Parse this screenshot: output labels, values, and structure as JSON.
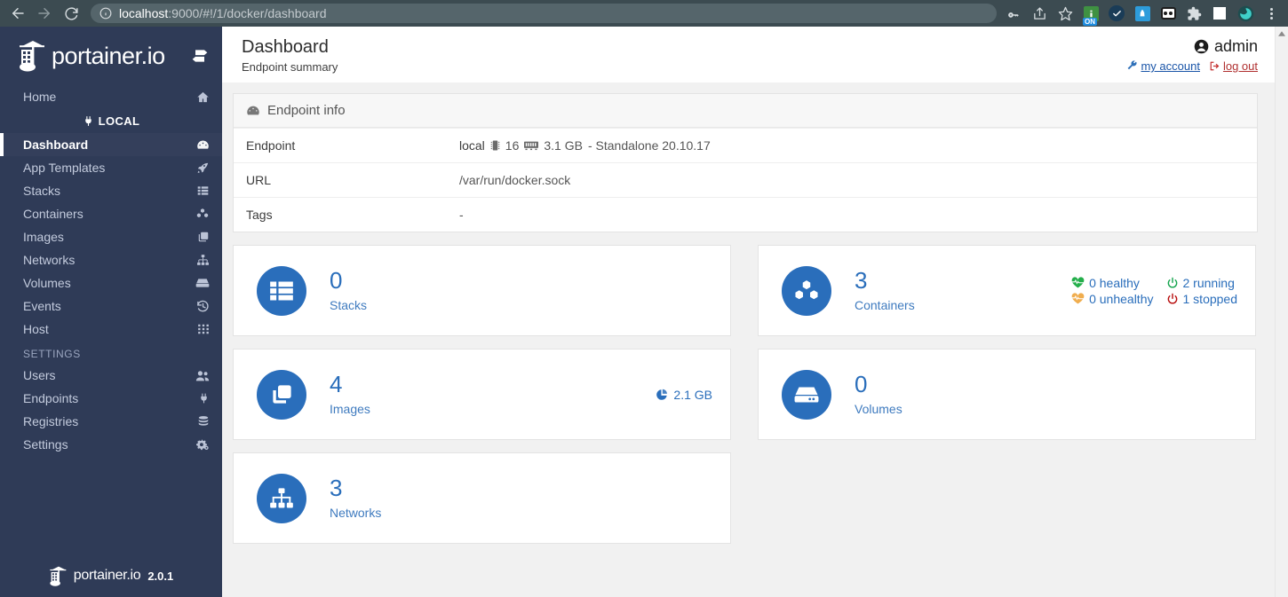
{
  "browser": {
    "back_icon": "back-arrow-icon",
    "forward_icon": "forward-arrow-icon",
    "reload_icon": "reload-icon",
    "site_info_icon": "site-info-icon",
    "url_host": "localhost",
    "url_rest": ":9000/#!/1/docker/dashboard",
    "url_full": "localhost:9000/#!/1/docker/dashboard",
    "toolbar_icons": [
      "password-key-icon",
      "share-icon",
      "bookmark-star-icon",
      "extension-on-icon",
      "extension-check-icon",
      "extension-bag-icon",
      "extension-goggles-icon",
      "extensions-puzzle-icon",
      "sidepanel-icon",
      "extension-swirl-icon",
      "chrome-menu-icon"
    ],
    "extension_badge": "ON"
  },
  "sidebar": {
    "logo_text": "portainer.io",
    "toggle_icon": "collapse-sidebar-icon",
    "home": {
      "label": "Home",
      "icon": "home-icon"
    },
    "local_badge": {
      "label": "LOCAL",
      "icon": "plug-icon"
    },
    "items": [
      {
        "label": "Dashboard",
        "icon": "dashboard-icon",
        "active": true
      },
      {
        "label": "App Templates",
        "icon": "rocket-icon",
        "active": false
      },
      {
        "label": "Stacks",
        "icon": "list-icon",
        "active": false
      },
      {
        "label": "Containers",
        "icon": "containers-icon",
        "active": false
      },
      {
        "label": "Images",
        "icon": "images-icon",
        "active": false
      },
      {
        "label": "Networks",
        "icon": "sitemap-icon",
        "active": false
      },
      {
        "label": "Volumes",
        "icon": "hdd-icon",
        "active": false
      },
      {
        "label": "Events",
        "icon": "history-icon",
        "active": false
      },
      {
        "label": "Host",
        "icon": "grid-icon",
        "active": false
      }
    ],
    "settings_title": "SETTINGS",
    "settings_items": [
      {
        "label": "Users",
        "icon": "users-icon"
      },
      {
        "label": "Endpoints",
        "icon": "plug-icon"
      },
      {
        "label": "Registries",
        "icon": "database-icon"
      },
      {
        "label": "Settings",
        "icon": "cogs-icon"
      }
    ],
    "footer": {
      "logo_text": "portainer.io",
      "version": "2.0.1"
    }
  },
  "header": {
    "title": "Dashboard",
    "subtitle": "Endpoint summary",
    "user_icon": "user-circle-icon",
    "user_name": "admin",
    "account_link": "my account",
    "account_icon": "wrench-icon",
    "logout_link": "log out",
    "logout_icon": "sign-out-icon"
  },
  "endpoint_panel": {
    "title": "Endpoint info",
    "title_icon": "tachometer-icon",
    "rows": [
      {
        "key": "Endpoint",
        "value": "local",
        "cpu_icon": "microchip-icon",
        "cpu": "16",
        "mem_icon": "memory-icon",
        "mem": "3.1 GB",
        "suffix": "- Standalone 20.10.17"
      },
      {
        "key": "URL",
        "value": "/var/run/docker.sock"
      },
      {
        "key": "Tags",
        "value": "-"
      }
    ]
  },
  "cards": [
    {
      "name": "stacks",
      "count": "0",
      "label": "Stacks",
      "icon": "stacks-icon"
    },
    {
      "name": "containers",
      "count": "3",
      "label": "Containers",
      "icon": "containers-cubes-icon",
      "statuses": [
        {
          "icon": "heartbeat-icon",
          "color": "#23ae4a",
          "text": "0 healthy"
        },
        {
          "icon": "power-icon",
          "color": "#14a44d",
          "text": "2 running"
        },
        {
          "icon": "heartbeat-icon",
          "color": "#f0ad4e",
          "text": "0 unhealthy"
        },
        {
          "icon": "power-icon",
          "color": "#b80d0d",
          "text": "1 stopped"
        }
      ]
    },
    {
      "name": "images",
      "count": "4",
      "label": "Images",
      "icon": "images-copy-icon",
      "size_icon": "pie-chart-icon",
      "size": "2.1 GB"
    },
    {
      "name": "volumes",
      "count": "0",
      "label": "Volumes",
      "icon": "hdd-icon"
    },
    {
      "name": "networks",
      "count": "3",
      "label": "Networks",
      "icon": "sitemap-icon"
    }
  ],
  "colors": {
    "sidebar_bg": "#2f3b57",
    "sidebar_active_bg": "#343f5b",
    "accent_blue": "#2a6ebb",
    "label_blue": "#3f7bbf",
    "browser_bg": "#3c4b51",
    "content_bg": "#f1f1f1",
    "link_blue": "#1a55a8",
    "link_red": "#b03030"
  }
}
